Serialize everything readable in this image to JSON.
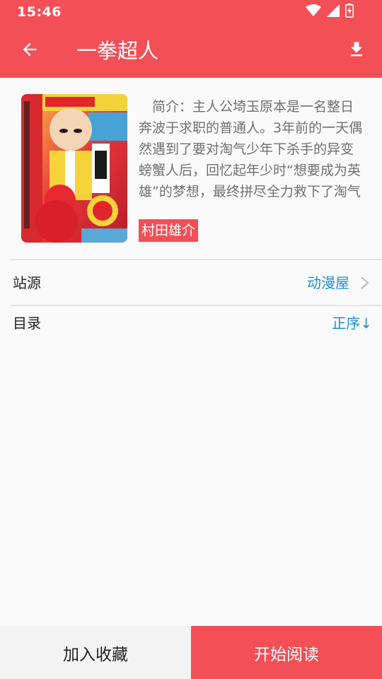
{
  "status_bar": {
    "time": "15:46"
  },
  "toolbar": {
    "title": "一拳超人",
    "back_icon": "arrow-left-icon",
    "download_icon": "download-icon"
  },
  "detail": {
    "synopsis": "简介：主人公埼玉原本是一名整日奔波于求职的普通人。3年前的一天偶然遇到了要对淘气少年下杀手的异变螃蟹人后，回忆起年少时“想要成为英雄”的梦想，最终拼尽全力救下了淘气少年。之后通…",
    "author": "村田雄介"
  },
  "source_row": {
    "label": "站源",
    "value": "动漫屋"
  },
  "catalog_row": {
    "label": "目录",
    "order": "正序↓"
  },
  "bottom_bar": {
    "collect_label": "加入收藏",
    "read_label": "开始阅读"
  },
  "colors": {
    "accent": "#f24f57",
    "link": "#1e8fd1"
  }
}
